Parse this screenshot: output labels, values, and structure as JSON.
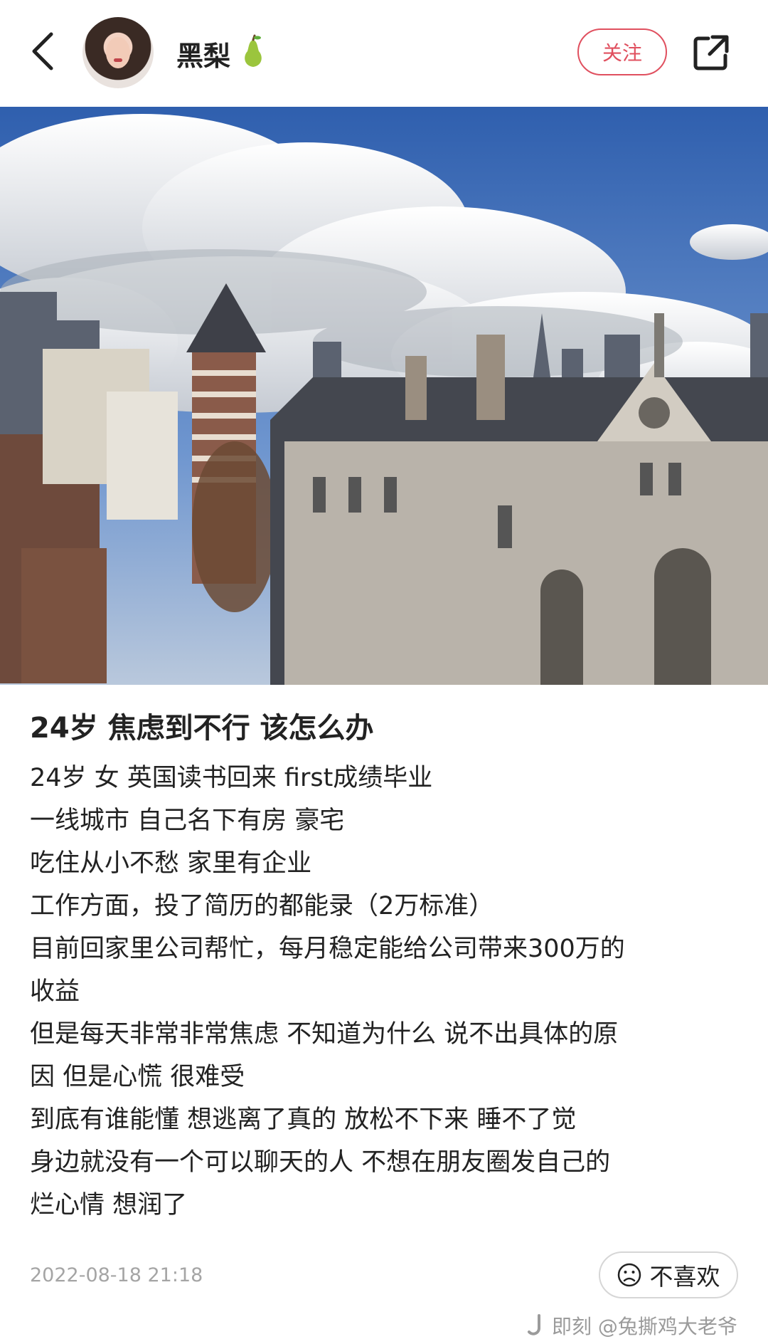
{
  "header": {
    "username": "黑梨",
    "follow_label": "关注"
  },
  "icons": {
    "back": "chevron-left-icon",
    "badge": "pear-icon",
    "share": "share-icon",
    "dislike": "sad-face-icon",
    "watermark": "jike-logo-icon"
  },
  "colors": {
    "accent": "#e0505f",
    "text": "#222222",
    "muted": "#a5a5a5"
  },
  "post": {
    "title": "24岁 焦虑到不行 该怎么办",
    "lines": [
      "24岁 女 英国读书回来 first成绩毕业",
      "一线城市 自己名下有房 豪宅",
      "吃住从小不愁 家里有企业",
      "工作方面，投了简历的都能录（2万标准）",
      "目前回家里公司帮忙，每月稳定能给公司带来300万的",
      "收益",
      "但是每天非常非常焦虑 不知道为什么 说不出具体的原",
      "因 但是心慌 很难受",
      "到底有谁能懂 想逃离了真的 放松不下来 睡不了觉",
      "身边就没有一个可以聊天的人 不想在朋友圈发自己的",
      "烂心情 想润了"
    ],
    "date": "2022-08-18 21:18",
    "dislike_label": "不喜欢"
  },
  "watermark": {
    "text": "即刻 @兔撕鸡大老爷"
  }
}
